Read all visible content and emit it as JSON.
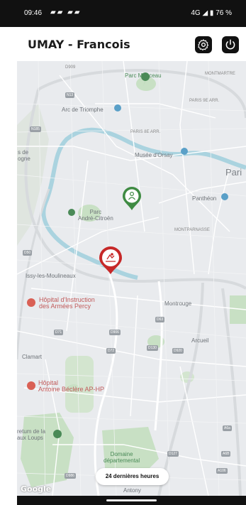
{
  "status_bar": {
    "time": "09:46",
    "notifications": "▰▰ ▰▰",
    "network": "4G ◢ ▮ 76 %"
  },
  "header": {
    "title": "UMAY - Francois",
    "settings_icon": "gear-icon",
    "power_icon": "power-icon"
  },
  "map": {
    "labels": {
      "d909": "D909",
      "parc_monceau": "Parc Monceau",
      "montmartre": "MONTMARTRE",
      "n13": "N13",
      "paris_9e": "PARIS 9E ARR.",
      "arc": "Arc de Triomphe",
      "paris_8e": "PARIS 8E ARR.",
      "n185": "N185",
      "boulogne": "s de\nogne",
      "orsay": "Musée d'Orsay",
      "paris": "Pari",
      "pantheon": "Panthéon",
      "parc_citroen": "Parc\nAndré-Citroën",
      "montparnasse": "MONTPARNASSE",
      "d50": "D50",
      "issy": "Issy-les-Moulineaux",
      "hopital_percy": "Hôpital d'Instruction\ndes Armées Percy",
      "montrouge": "Montrouge",
      "d63": "D63",
      "d71": "D71",
      "d906": "D906",
      "d72": "D72",
      "d130": "D130",
      "d920": "D920",
      "arcueil": "Arcueil",
      "clamart": "Clamart",
      "hopital_beclere": "Hôpital\nAntoine Béclère AP-HP",
      "loups": "retum de la\naux Loups",
      "a6a": "A6a",
      "domaine": "Domaine\ndépartemental",
      "d127": "D127",
      "a6b": "A6B",
      "d986": "D986",
      "a106": "A106",
      "antony": "Antony"
    },
    "time_range_button": "24 dernières heures",
    "attribution": "Google"
  },
  "colors": {
    "marker_green": "#3f8b43",
    "marker_red": "#c62828",
    "park": "#c8e0c4",
    "water": "#aad3df",
    "road": "#ffffff"
  }
}
